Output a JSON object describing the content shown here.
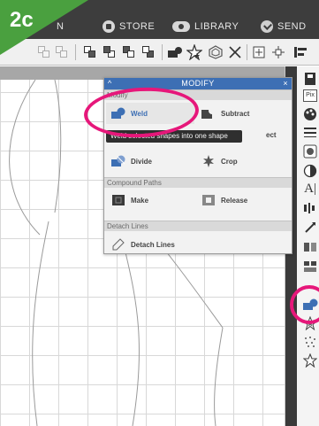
{
  "step": "2c",
  "nav": {
    "partial_tab": "N",
    "store": "STORE",
    "library": "LIBRARY",
    "send": "SEND"
  },
  "panel": {
    "title": "MODIFY",
    "collapse_glyph": "^",
    "close_glyph": "×",
    "section_modify": "Modify",
    "weld": "Weld",
    "subtract": "Subtract",
    "intersect_partial": "ect",
    "divide": "Divide",
    "crop": "Crop",
    "section_compound": "Compound Paths",
    "make": "Make",
    "release": "Release",
    "section_detach": "Detach Lines",
    "detach_lines": "Detach Lines"
  },
  "tooltip": "Weld selected shapes into one shape",
  "right_tools": {
    "pix_label": "Pix",
    "text_tool_label": "A|"
  },
  "colors": {
    "highlight": "#e6177a",
    "badge": "#4aa03f",
    "panel_header": "#3d6fb4",
    "modify_icon": "#3d6fb4"
  },
  "icons": [
    "store-icon",
    "library-icon",
    "send-icon",
    "weld-icon",
    "subtract-icon",
    "divide-icon",
    "crop-icon",
    "make-icon",
    "release-icon",
    "detach-lines-icon"
  ]
}
